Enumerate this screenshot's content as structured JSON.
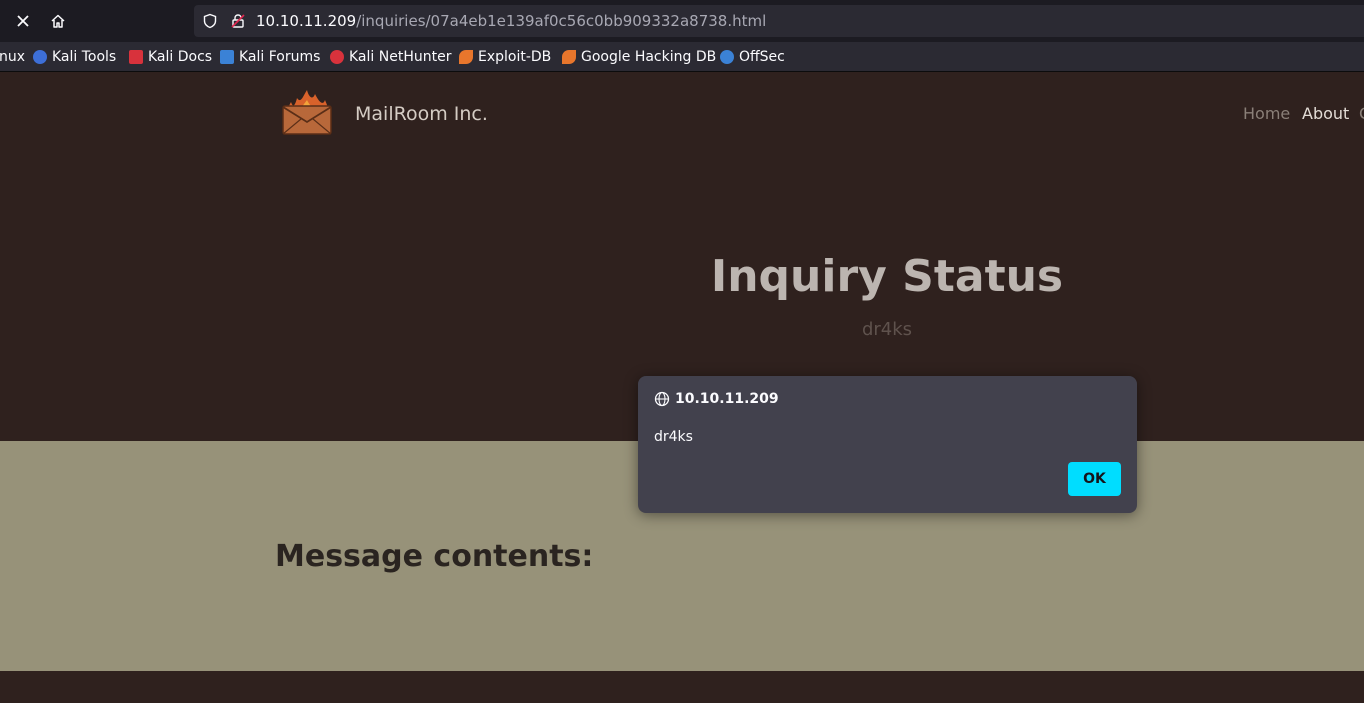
{
  "browser": {
    "url_host": "10.10.11.209",
    "url_path": "/inquiries/07a4eb1e139af0c56c0bb909332a8738.html",
    "icons": [
      "close-icon",
      "home-icon",
      "shield-icon",
      "lock-icon"
    ],
    "bookmarks": [
      {
        "label": "nux",
        "icon": "none",
        "color": ""
      },
      {
        "label": "Kali Tools",
        "icon": "kali-tools-icon",
        "color": "#3d6fd8"
      },
      {
        "label": "Kali Docs",
        "icon": "kali-docs-icon",
        "color": "#d8323c"
      },
      {
        "label": "Kali Forums",
        "icon": "kali-forums-icon",
        "color": "#3b82d6"
      },
      {
        "label": "Kali NetHunter",
        "icon": "nethunter-icon",
        "color": "#d8323c"
      },
      {
        "label": "Exploit-DB",
        "icon": "exploit-db-icon",
        "color": "#e8762c"
      },
      {
        "label": "Google Hacking DB",
        "icon": "ghdb-icon",
        "color": "#e8762c"
      },
      {
        "label": "OffSec",
        "icon": "offsec-icon",
        "color": "#3b82d6"
      }
    ]
  },
  "site": {
    "brand": "MailRoom Inc.",
    "nav": {
      "home": "Home",
      "about": "About",
      "extra": "C"
    },
    "title": "Inquiry Status",
    "subtitle": "dr4ks",
    "message_heading": "Message contents:"
  },
  "dialog": {
    "origin": "10.10.11.209",
    "message": "dr4ks",
    "ok_label": "OK",
    "accent": "#00ddff"
  }
}
